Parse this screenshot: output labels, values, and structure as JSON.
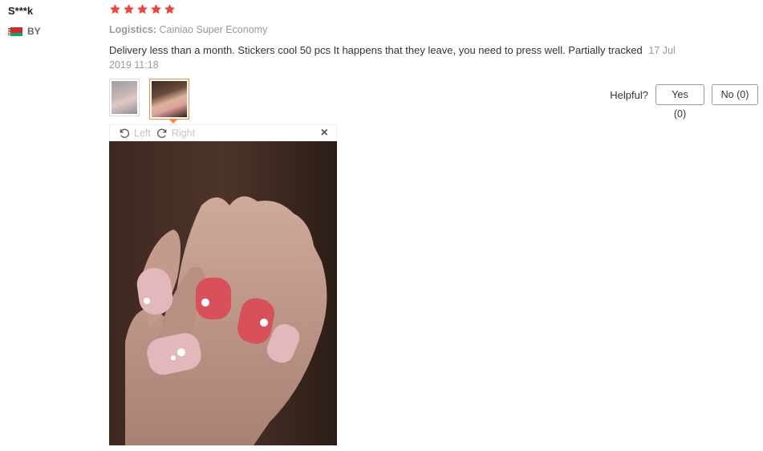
{
  "reviewer": {
    "name": "S***k",
    "country_code": "BY"
  },
  "rating": {
    "stars": 5,
    "max": 5,
    "color": "#f44336"
  },
  "logistics": {
    "label": "Logistics:",
    "value": "Cainiao Super Economy"
  },
  "review": {
    "text": "Delivery less than a month. Stickers cool 50 pcs It happens that they leave, you need to press well. Partially tracked",
    "date": "17 Jul 2019 11:18"
  },
  "thumbnails": [
    {
      "name": "thumbnail-1",
      "active": false
    },
    {
      "name": "thumbnail-2",
      "active": true
    }
  ],
  "helpful": {
    "label": "Helpful?",
    "yes_label": "Yes (0)",
    "no_label": "No (0)"
  },
  "viewer": {
    "rotate_left_label": "Left",
    "rotate_right_label": "Right",
    "close_icon": "×",
    "icons": [
      "rotate-left-icon",
      "rotate-right-icon",
      "close-icon"
    ]
  },
  "colors": {
    "accent_orange": "#ff8a3d",
    "star_red": "#f44336",
    "muted_gray": "#999999"
  }
}
